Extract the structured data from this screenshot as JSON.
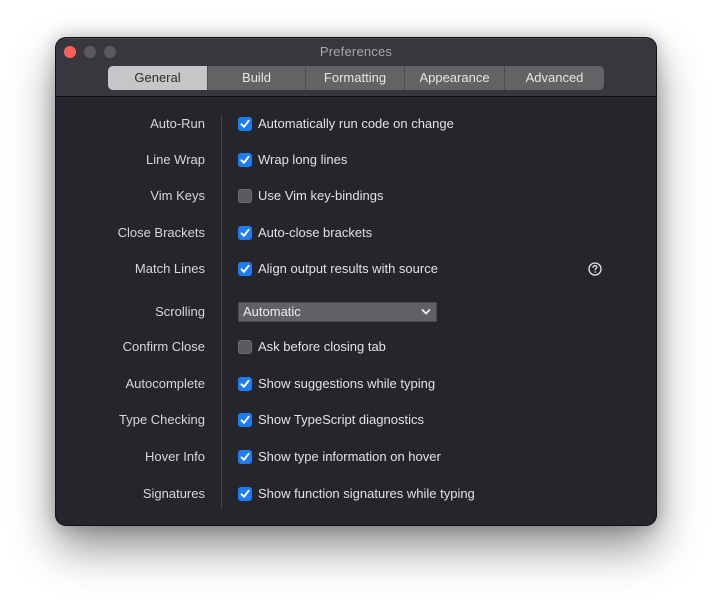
{
  "window": {
    "title": "Preferences",
    "controls": [
      "close",
      "minimize",
      "zoom"
    ]
  },
  "tabs": [
    {
      "label": "General",
      "active": true
    },
    {
      "label": "Build",
      "active": false
    },
    {
      "label": "Formatting",
      "active": false
    },
    {
      "label": "Appearance",
      "active": false
    },
    {
      "label": "Advanced",
      "active": false
    }
  ],
  "settings": [
    {
      "label": "Auto-Run",
      "type": "checkbox",
      "checked": true,
      "text": "Automatically run code on change"
    },
    {
      "label": "Line Wrap",
      "type": "checkbox",
      "checked": true,
      "text": "Wrap long lines"
    },
    {
      "label": "Vim Keys",
      "type": "checkbox",
      "checked": false,
      "text": "Use Vim key-bindings"
    },
    {
      "label": "Close Brackets",
      "type": "checkbox",
      "checked": true,
      "text": "Auto-close brackets"
    },
    {
      "label": "Match Lines",
      "type": "checkbox",
      "checked": true,
      "text": "Align output results with source",
      "help_icon": "question-circle-icon"
    },
    {
      "label": "Scrolling",
      "type": "select",
      "value": "Automatic"
    },
    {
      "label": "Confirm Close",
      "type": "checkbox",
      "checked": false,
      "text": "Ask before closing tab"
    },
    {
      "label": "Autocomplete",
      "type": "checkbox",
      "checked": true,
      "text": "Show suggestions while typing"
    },
    {
      "label": "Type Checking",
      "type": "checkbox",
      "checked": true,
      "text": "Show TypeScript diagnostics"
    },
    {
      "label": "Hover Info",
      "type": "checkbox",
      "checked": true,
      "text": "Show type information on hover"
    },
    {
      "label": "Signatures",
      "type": "checkbox",
      "checked": true,
      "text": "Show function signatures while typing"
    }
  ],
  "colors": {
    "accent": "#1b7cf5",
    "close_button": "#ff5f57",
    "window_bg": "#25262b",
    "titlebar_bg": "#37373d"
  }
}
